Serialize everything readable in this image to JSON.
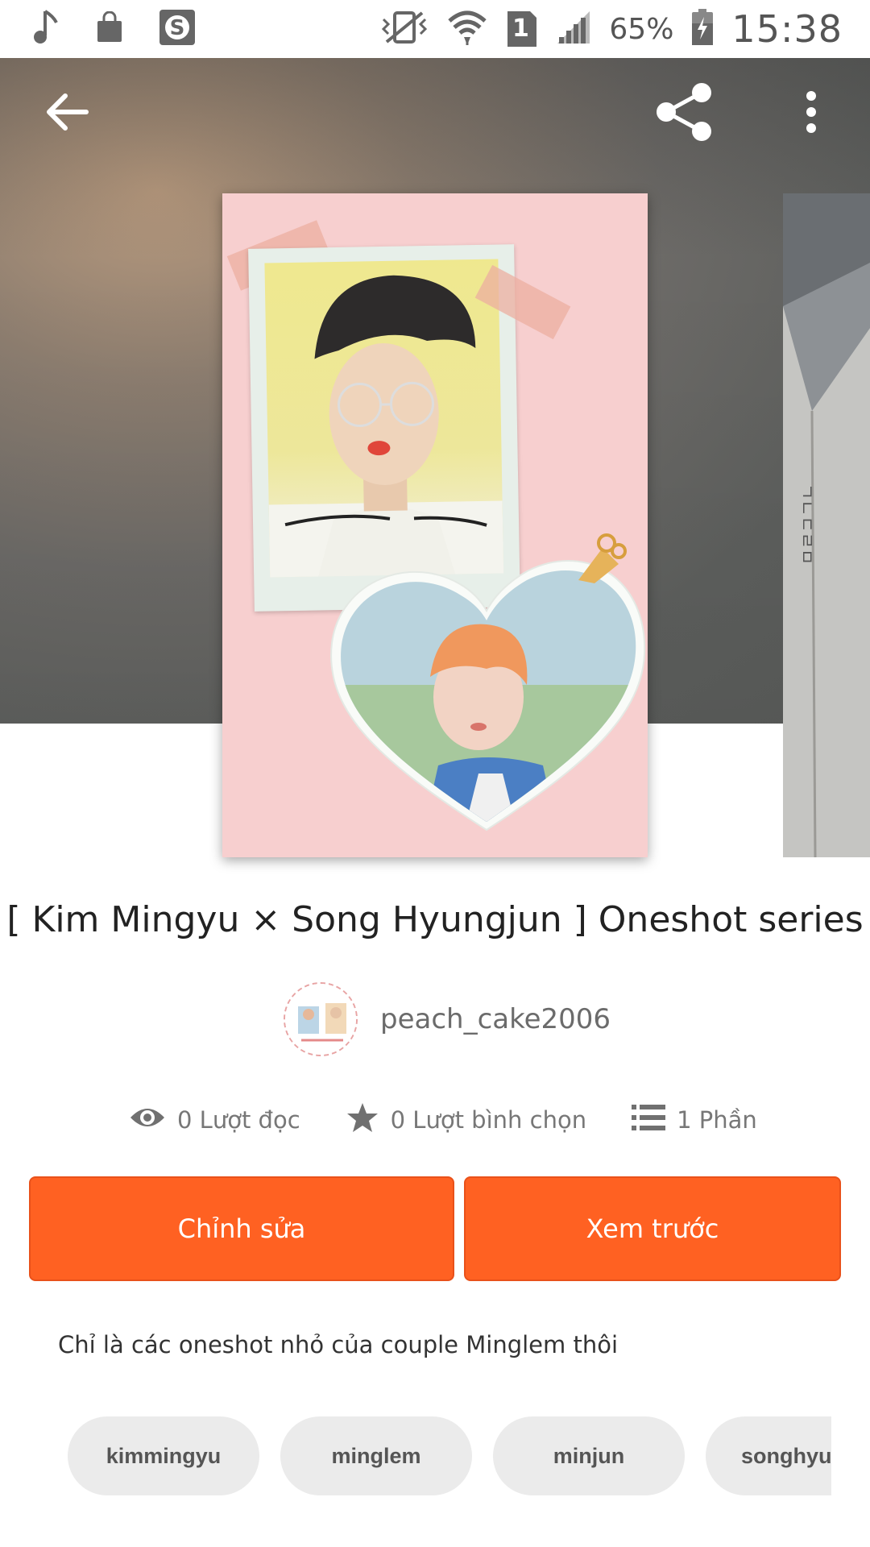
{
  "status_bar": {
    "battery_percent": "65%",
    "time": "15:38",
    "sim_slot": "1",
    "icons": [
      "music-note-icon",
      "shopping-bag-icon",
      "skype-icon",
      "vibrate-icon",
      "wifi-icon",
      "sim-icon",
      "signal-icon",
      "battery-charging-icon"
    ]
  },
  "app_bar": {
    "icons": [
      "back-arrow-icon",
      "share-icon",
      "overflow-menu-icon"
    ]
  },
  "story": {
    "title": "[ Kim Mingyu × Song Hyungjun ] Oneshot series",
    "author": "peach_cake2006",
    "stats": {
      "reads": "0 Lượt đọc",
      "votes": "0 Lượt bình chọn",
      "parts": "1 Phần"
    },
    "description": "Chỉ là các oneshot nhỏ của couple Minglem thôi",
    "tags": [
      "kimmingyu",
      "minglem",
      "minjun",
      "songhyu"
    ]
  },
  "actions": {
    "edit_label": "Chỉnh sửa",
    "preview_label": "Xem trước"
  },
  "colors": {
    "accent": "#ff6122",
    "tag_bg": "#ebebeb"
  }
}
